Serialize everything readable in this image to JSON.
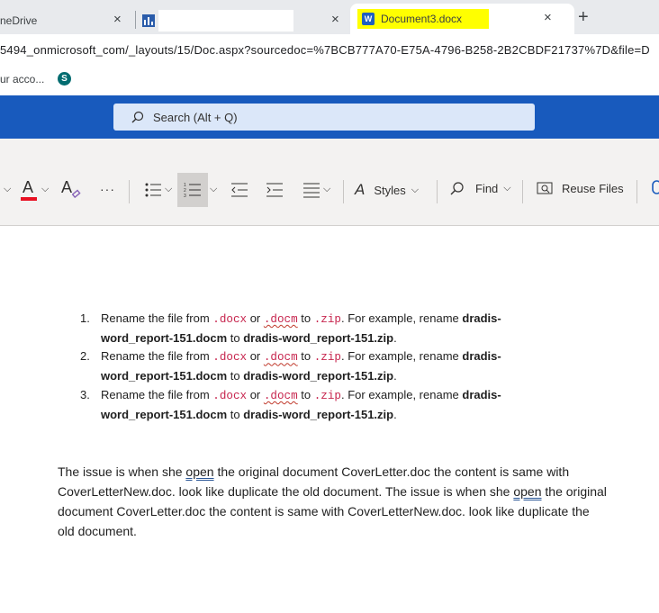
{
  "browser": {
    "tabs": [
      {
        "title": "OneDrive",
        "visible_text": "neDrive",
        "close": "×"
      },
      {
        "title": "",
        "visible_text": "",
        "close": "×"
      },
      {
        "title": "Document3.docx",
        "close": "×"
      }
    ],
    "new_tab": "+",
    "url": "5494_onmicrosoft_com/_layouts/15/Doc.aspx?sourcedoc=%7BCB777A70-E75A-4796-B258-2B2CBDF21737%7D&file=D",
    "bookmark_label": "ur acco...",
    "bookmark_icon_letter": "S"
  },
  "word": {
    "search_placeholder": "Search (Alt + Q)",
    "ribbon": {
      "more": "···",
      "styles": "Styles",
      "find": "Find",
      "reuse_files": "Reuse Files"
    }
  },
  "document": {
    "list_items": [
      {
        "n": "1.",
        "t1": "Rename the file from ",
        "ext1": ".docx",
        "or": " or ",
        "ext2": ".docm",
        "to": " to ",
        "ext3": ".zip",
        "t2": ". For example, rename ",
        "b1": "dradis-word_report-151.docm",
        "t3": " to ",
        "b2": "dradis-word_report-151.zip",
        "t4": "."
      },
      {
        "n": "2.",
        "t1": "Rename the file from ",
        "ext1": ".docx",
        "or": " or ",
        "ext2": ".docm",
        "to": " to ",
        "ext3": ".zip",
        "t2": ". For example, rename ",
        "b1": "dradis-word_report-151.docm",
        "t3": " to ",
        "b2": "dradis-word_report-151.zip",
        "t4": "."
      },
      {
        "n": "3.",
        "t1": "Rename the file from ",
        "ext1": ".docx",
        "or": " or ",
        "ext2": ".docm",
        "to": " to ",
        "ext3": ".zip",
        "t2": ". For example, rename ",
        "b1": "dradis-word_report-151.docm",
        "t3": " to ",
        "b2": "dradis-word_report-151.zip",
        "t4": "."
      }
    ],
    "paragraph": {
      "p1": "The issue is when she ",
      "open1": "open",
      "p2": " the original document CoverLetter.doc the content is same with CoverLetterNew.doc. look like duplicate the old document.  The issue is when she ",
      "open2": "open",
      "p3": " the original document CoverLetter.doc the content is same with CoverLetterNew.doc. look like duplicate the old document."
    }
  },
  "colors": {
    "word_blue": "#185abd",
    "ribbon_bg": "#f3f2f1",
    "font_color_red": "#e81123",
    "highlight_yellow": "#ffff00",
    "code_red": "#c7254e"
  }
}
